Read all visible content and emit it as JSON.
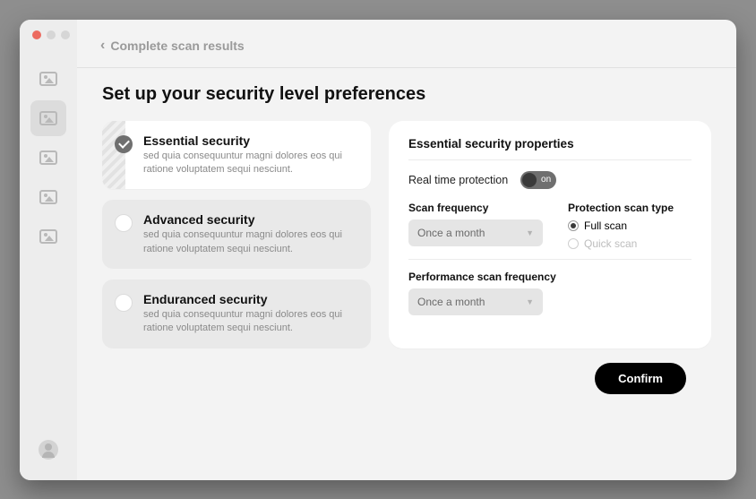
{
  "header": {
    "breadcrumb": "Complete scan results"
  },
  "title": "Set up your security level preferences",
  "options": [
    {
      "title": "Essential security",
      "desc": "sed quia consequuntur magni dolores eos qui ratione voluptatem sequi nesciunt.",
      "selected": true
    },
    {
      "title": "Advanced security",
      "desc": "sed quia consequuntur magni dolores eos qui ratione voluptatem sequi nesciunt.",
      "selected": false
    },
    {
      "title": "Enduranced security",
      "desc": "sed quia consequuntur magni dolores eos qui ratione voluptatem sequi nesciunt.",
      "selected": false
    }
  ],
  "panel": {
    "heading": "Essential security properties",
    "realtime_label": "Real time protection",
    "toggle_state": "on",
    "scan_freq_label": "Scan frequency",
    "scan_freq_value": "Once a month",
    "protection_type_label": "Protection scan type",
    "protection_options": {
      "full": "Full scan",
      "quick": "Quick scan",
      "selected": "full"
    },
    "perf_label": "Performance scan frequency",
    "perf_value": "Once a month"
  },
  "confirm_label": "Confirm"
}
